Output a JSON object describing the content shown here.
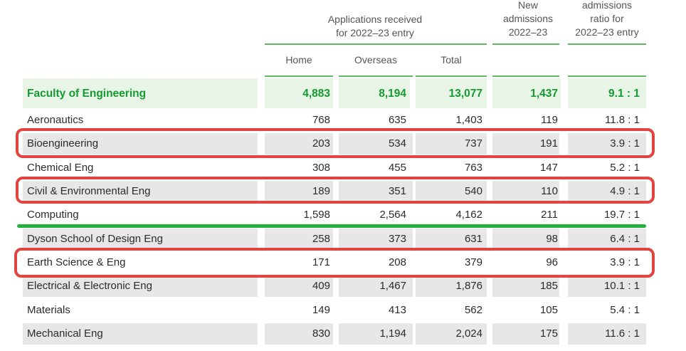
{
  "headers": {
    "applications_line1": "Applications received",
    "applications_line2": "for 2022–23 entry",
    "new_line1": "New",
    "new_line2": "admissions",
    "new_line3": "2022–23",
    "ratio_line1": "admissions",
    "ratio_line2": "ratio for",
    "ratio_line3": "2022–23 entry",
    "home": "Home",
    "overseas": "Overseas",
    "total": "Total"
  },
  "faculty": {
    "name": "Faculty of Engineering",
    "home": "4,883",
    "overseas": "8,194",
    "total": "13,077",
    "admissions": "1,437",
    "ratio": "9.1 : 1"
  },
  "rows": [
    {
      "name": "Aeronautics",
      "home": "768",
      "overseas": "635",
      "total": "1,403",
      "admissions": "119",
      "ratio": "11.8 : 1"
    },
    {
      "name": "Bioengineering",
      "home": "203",
      "overseas": "534",
      "total": "737",
      "admissions": "191",
      "ratio": "3.9 : 1"
    },
    {
      "name": "Chemical Eng",
      "home": "308",
      "overseas": "455",
      "total": "763",
      "admissions": "147",
      "ratio": "5.2 : 1"
    },
    {
      "name": "Civil & Environmental Eng",
      "home": "189",
      "overseas": "351",
      "total": "540",
      "admissions": "110",
      "ratio": "4.9 : 1"
    },
    {
      "name": "Computing",
      "home": "1,598",
      "overseas": "2,564",
      "total": "4,162",
      "admissions": "211",
      "ratio": "19.7 : 1"
    },
    {
      "name": "Dyson School of Design Eng",
      "home": "258",
      "overseas": "373",
      "total": "631",
      "admissions": "98",
      "ratio": "6.4 : 1"
    },
    {
      "name": "Earth Science & Eng",
      "home": "171",
      "overseas": "208",
      "total": "379",
      "admissions": "96",
      "ratio": "3.9 : 1"
    },
    {
      "name": "Electrical & Electronic Eng",
      "home": "409",
      "overseas": "1,467",
      "total": "1,876",
      "admissions": "185",
      "ratio": "10.1 : 1"
    },
    {
      "name": "Materials",
      "home": "149",
      "overseas": "413",
      "total": "562",
      "admissions": "105",
      "ratio": "5.4 : 1"
    },
    {
      "name": "Mechanical Eng",
      "home": "830",
      "overseas": "1,194",
      "total": "2,024",
      "admissions": "175",
      "ratio": "11.6 : 1"
    }
  ],
  "colors": {
    "faculty_green": "#159a32",
    "rule_green": "#5fb85f",
    "faculty_bg": "#e8f5e6",
    "stripe_gray": "#e7e7e7",
    "annotation_red": "#e0453f",
    "annotation_green": "#24b33a"
  }
}
